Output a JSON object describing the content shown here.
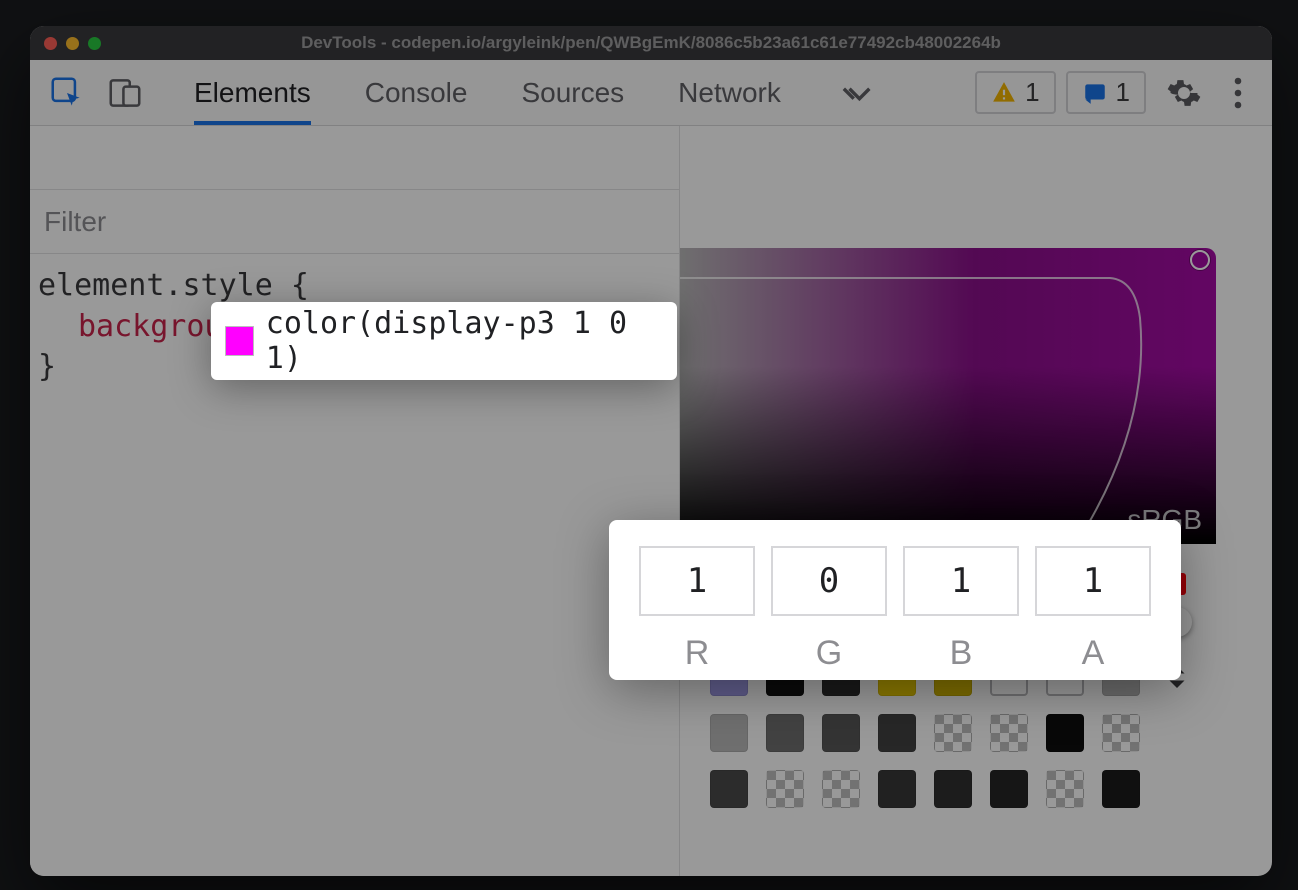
{
  "window": {
    "title": "DevTools - codepen.io/argyleink/pen/QWBgEmK/8086c5b23a61c61e77492cb48002264b"
  },
  "toolbar": {
    "tabs": [
      {
        "label": "Elements",
        "active": true
      },
      {
        "label": "Console",
        "active": false
      },
      {
        "label": "Sources",
        "active": false
      },
      {
        "label": "Network",
        "active": false
      }
    ],
    "warnings_count": "1",
    "issues_count": "1"
  },
  "styles": {
    "filter_placeholder": "Filter",
    "selector": "element.style",
    "open_brace": "{",
    "close_brace": "}",
    "property": "background",
    "value": "color(display-p3 1 0 1)",
    "swatch_color": "#ff00ff"
  },
  "picker": {
    "gamut_label": "sRGB",
    "preview_color": "#9a0f9a",
    "channels": {
      "r": {
        "label": "R",
        "value": "1"
      },
      "g": {
        "label": "G",
        "value": "0"
      },
      "b": {
        "label": "B",
        "value": "1"
      },
      "a": {
        "label": "A",
        "value": "1"
      }
    },
    "swatch_rows": [
      [
        "#9e9ae6",
        "#111111",
        "#2b2b2b",
        "#e6c800",
        "#d0b400",
        "outline",
        "outline",
        "#b3b3b3"
      ],
      [
        "#bababa",
        "#6e6e6e",
        "#575757",
        "#424242",
        "checker",
        "checker",
        "#0e0e0e",
        "checker"
      ],
      [
        "#4a4a4a",
        "checker",
        "checker",
        "#383838",
        "#2f2f2f",
        "#262626",
        "checker",
        "#1c1c1c"
      ]
    ]
  }
}
